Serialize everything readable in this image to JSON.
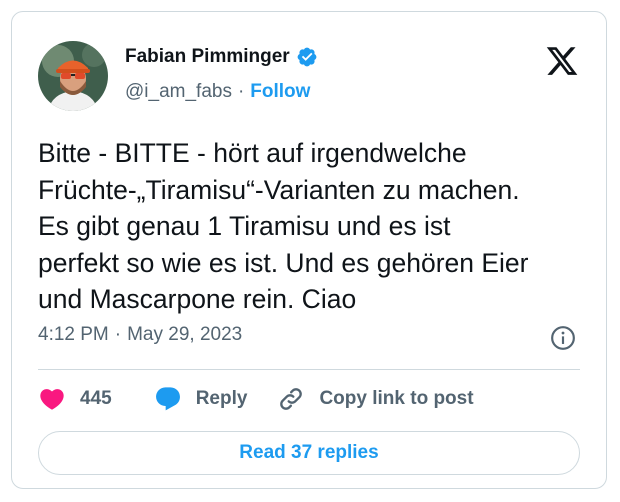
{
  "author": {
    "name": "Fabian Pimminger",
    "handle": "@i_am_fabs",
    "separator": "·",
    "follow_label": "Follow"
  },
  "icons": {
    "verified": "verified-badge-icon",
    "platform": "x-logo-icon",
    "info": "info-icon",
    "like": "heart-icon",
    "reply": "speech-bubble-icon",
    "copy": "link-icon"
  },
  "tweet": {
    "text": "Bitte - BITTE - hört auf irgendwelche\nFrüchte-„Tiramisu“-Varianten zu machen.\nEs gibt genau 1 Tiramisu und es ist\nperfekt so wie es ist. Und es gehören Eier\nund Mascarpone rein. Ciao",
    "time": "4:12 PM",
    "separator": "·",
    "date": "May 29, 2023"
  },
  "actions": {
    "likes": "445",
    "reply_label": "Reply",
    "copy_label": "Copy link to post"
  },
  "footer": {
    "read_replies_label": "Read 37 replies"
  },
  "colors": {
    "accent": "#1d9bf0",
    "like": "#f91880",
    "text": "#0f1419",
    "muted": "#536471",
    "border": "#cfd9de"
  }
}
